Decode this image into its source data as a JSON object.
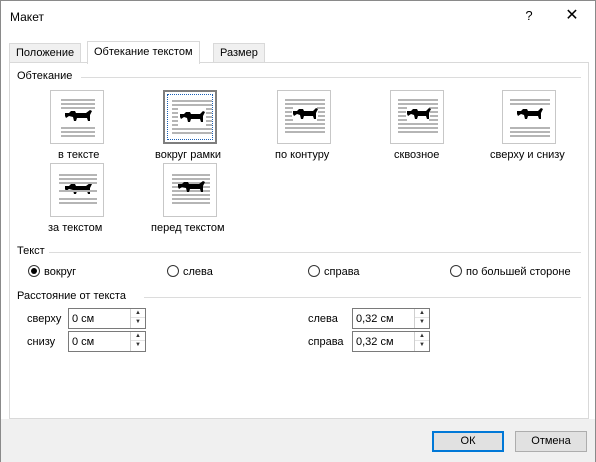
{
  "window": {
    "title": "Макет",
    "help": "?",
    "close": "✕"
  },
  "tabs": [
    {
      "label": "Положение"
    },
    {
      "label": "Обтекание текстом"
    },
    {
      "label": "Размер"
    }
  ],
  "wrapping": {
    "title": "Обтекание",
    "options": [
      {
        "label": "в тексте",
        "selected": false
      },
      {
        "label": "вокруг рамки",
        "selected": true
      },
      {
        "label": "по контуру",
        "selected": false
      },
      {
        "label": "сквозное",
        "selected": false
      },
      {
        "label": "сверху и снизу",
        "selected": false
      },
      {
        "label": "за текстом",
        "selected": false
      },
      {
        "label": "перед текстом",
        "selected": false
      }
    ]
  },
  "text": {
    "title": "Текст",
    "options": [
      {
        "label": "вокруг",
        "checked": true
      },
      {
        "label": "слева",
        "checked": false
      },
      {
        "label": "справа",
        "checked": false
      },
      {
        "label": "по большей стороне",
        "checked": false
      }
    ]
  },
  "distance": {
    "title": "Расстояние от текста",
    "top_label": "сверху",
    "top_value": "0 см",
    "bottom_label": "снизу",
    "bottom_value": "0 см",
    "left_label": "слева",
    "left_value": "0,32 см",
    "right_label": "справа",
    "right_value": "0,32 см"
  },
  "buttons": {
    "ok": "ОК",
    "cancel": "Отмена"
  },
  "colors": {
    "accent": "#0078d7",
    "footer": "#f0f0f0"
  }
}
